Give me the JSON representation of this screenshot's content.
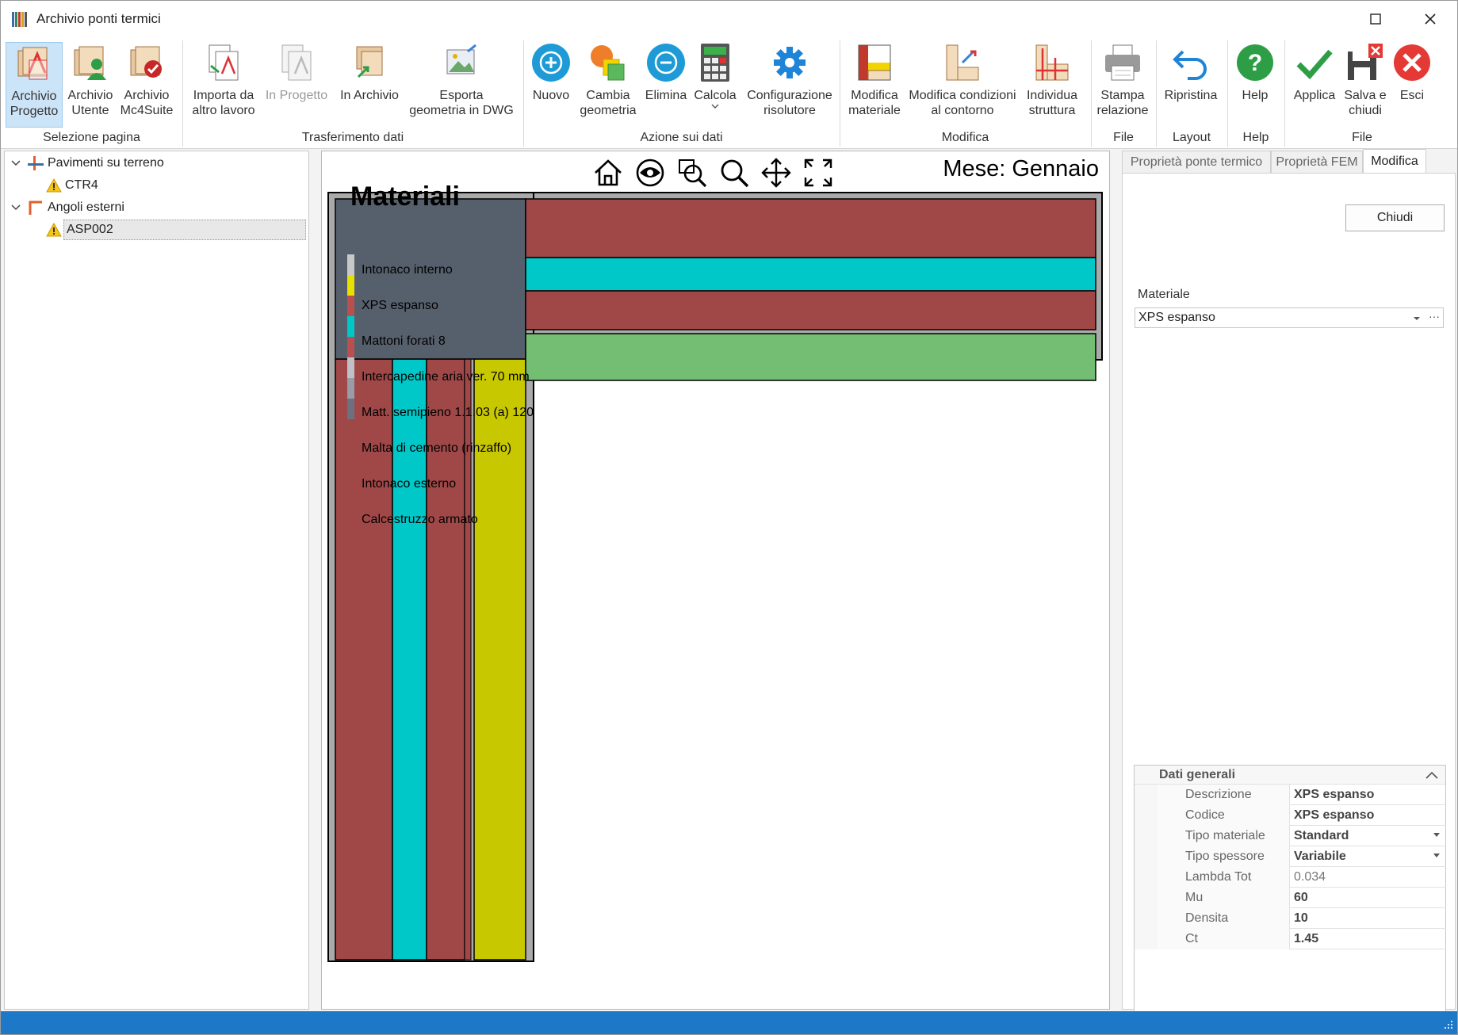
{
  "window": {
    "title": "Archivio ponti termici"
  },
  "ribbon": {
    "buttons": [
      {
        "label1": "Archivio",
        "label2": "Progetto"
      },
      {
        "label1": "Archivio",
        "label2": "Utente"
      },
      {
        "label1": "Archivio",
        "label2": "Mc4Suite"
      },
      {
        "label1": "Importa da",
        "label2": "altro lavoro"
      },
      {
        "label1": "In Progetto",
        "label2": ""
      },
      {
        "label1": "In Archivio",
        "label2": ""
      },
      {
        "label1": "Esporta",
        "label2": "geometria in DWG"
      },
      {
        "label1": "Nuovo",
        "label2": ""
      },
      {
        "label1": "Cambia",
        "label2": "geometria"
      },
      {
        "label1": "Elimina",
        "label2": ""
      },
      {
        "label1": "Calcola",
        "label2": ""
      },
      {
        "label1": "Configurazione",
        "label2": "risolutore"
      },
      {
        "label1": "Modifica",
        "label2": "materiale"
      },
      {
        "label1": "Modifica condizioni",
        "label2": "al contorno"
      },
      {
        "label1": "Individua",
        "label2": "struttura"
      },
      {
        "label1": "Stampa",
        "label2": "relazione"
      },
      {
        "label1": "Ripristina",
        "label2": ""
      },
      {
        "label1": "Help",
        "label2": ""
      },
      {
        "label1": "Applica",
        "label2": ""
      },
      {
        "label1": "Salva e",
        "label2": "chiudi"
      },
      {
        "label1": "Esci",
        "label2": ""
      }
    ],
    "groups": [
      "Selezione pagina",
      "Trasferimento dati",
      "Azione sui dati",
      "Modifica",
      "File",
      "Layout",
      "Help",
      "File"
    ]
  },
  "tree": {
    "nodes": [
      {
        "label": "Pavimenti su terreno"
      },
      {
        "label": "CTR4"
      },
      {
        "label": "Angoli esterni"
      },
      {
        "label": "ASP002"
      }
    ]
  },
  "canvas": {
    "title": "Materiali",
    "month": "Mese: Gennaio",
    "legend": [
      "Intonaco interno",
      "XPS espanso",
      "Mattoni forati 8",
      "Intercapedine aria ver. 70 mm",
      "Matt. semipieno 1.1.03 (a) 120",
      "Malta di cemento (rinzaffo)",
      "Intonaco esterno",
      "Calcestruzzo armato"
    ],
    "colors": {
      "brick": "#a04848",
      "cyan": "#00c8c8",
      "green": "#74be74",
      "yellow": "#c8c800",
      "concrete": "#56606c",
      "plaster": "#aaaaaa"
    }
  },
  "rpanel": {
    "tabs": [
      "Proprietà ponte termico",
      "Proprietà FEM",
      "Modifica"
    ],
    "close_label": "Chiudi",
    "material_label": "Materiale",
    "material_value": "XPS espanso",
    "combo_more": "···",
    "grid_header": "Dati generali",
    "props": [
      {
        "key": "Descrizione",
        "value": "XPS espanso"
      },
      {
        "key": "Codice",
        "value": "XPS espanso"
      },
      {
        "key": "Tipo materiale",
        "value": "Standard"
      },
      {
        "key": "Tipo spessore",
        "value": "Variabile"
      },
      {
        "key": "Lambda Tot",
        "value": "0.034"
      },
      {
        "key": "Mu",
        "value": "60"
      },
      {
        "key": "Densita",
        "value": "10"
      },
      {
        "key": "Ct",
        "value": "1.45"
      }
    ]
  }
}
